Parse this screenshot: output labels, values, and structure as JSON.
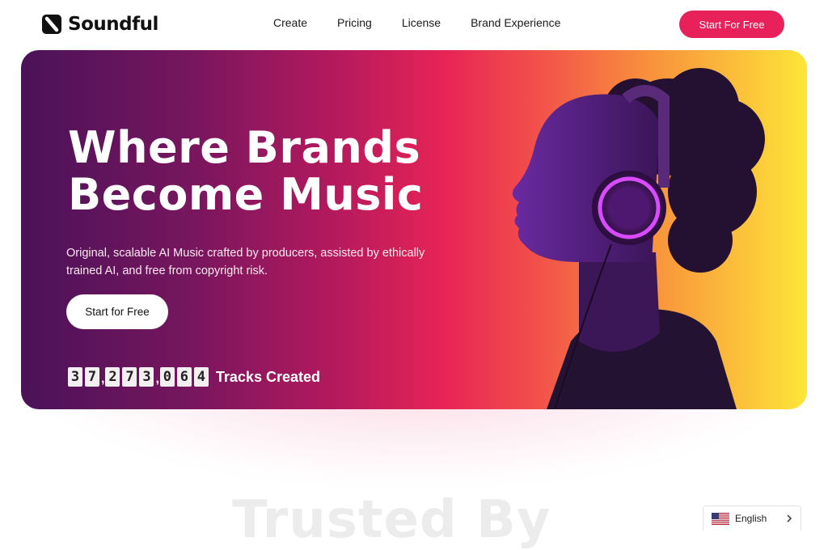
{
  "brand": {
    "name": "Soundful",
    "logo_icon": "soundful-s-icon"
  },
  "nav": {
    "items": [
      {
        "label": "Create"
      },
      {
        "label": "Pricing"
      },
      {
        "label": "License"
      },
      {
        "label": "Brand Experience"
      }
    ],
    "cta_label": "Start For Free"
  },
  "hero": {
    "title_line1": "Where Brands",
    "title_line2": "Become Music",
    "subtitle": "Original, scalable AI Music crafted by producers, assisted by ethically trained AI, and free from copyright risk.",
    "cta_label": "Start for Free",
    "counter": {
      "digits": [
        "3",
        "7",
        "2",
        "7",
        "3",
        "0",
        "6",
        "4"
      ],
      "separator": ",",
      "label": "Tracks Created"
    },
    "gradient_colors": [
      "#4a1258",
      "#e82456",
      "#fde637"
    ]
  },
  "section": {
    "heading": "Trusted By"
  },
  "language": {
    "label": "English",
    "flag_icon": "us-flag-icon",
    "chevron_icon": "chevron-right-icon"
  },
  "colors": {
    "accent": "#e8215a",
    "text": "#111111",
    "background": "#ffffff"
  }
}
